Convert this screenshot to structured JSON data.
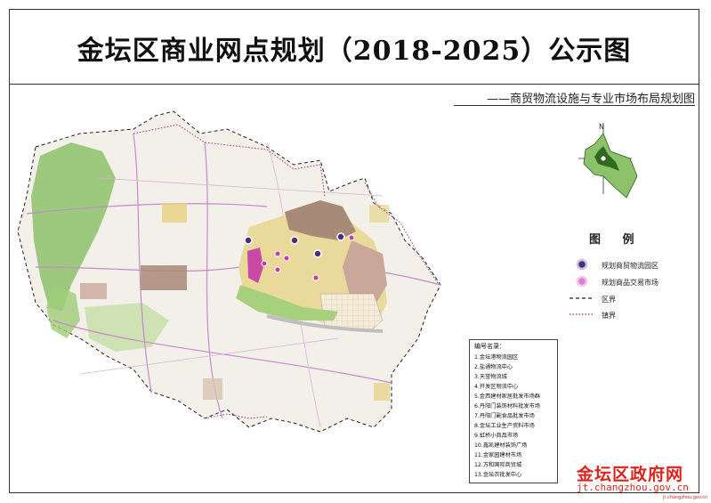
{
  "header": {
    "title": "金坛区商业网点规划（2018-2025）公示图",
    "subtitle": "——商贸物流设施与专业市场布局规划图"
  },
  "compass": {
    "north_label": "N"
  },
  "legend": {
    "title": "图 例",
    "items": [
      {
        "label": "规划商贸物流园区",
        "symbol": "purple-ringed-circle"
      },
      {
        "label": "规划商品交易市场",
        "symbol": "magenta-ringed-circle"
      },
      {
        "label": "区界",
        "symbol": "black-dashed-line"
      },
      {
        "label": "镇界",
        "symbol": "magenta-dotted-line"
      }
    ]
  },
  "numbering": {
    "title": "编号名录：",
    "items": [
      "1.金坛港物流园区",
      "2.盐通物流中心",
      "3.天誉物流城",
      "4.开发区物流中心",
      "5.金西建材家居批发市场群",
      "6.丹阳门装饰材料批发市场",
      "7.丹阳门副食品批发市场",
      "8.金坛工业生产资料市场",
      "9.虹桥小商品市场",
      "10.鑫凯建材装饰广场",
      "11.金家园建材市场",
      "12.方和国际商贸城",
      "13.金坛农批发中心"
    ]
  },
  "watermark": {
    "name": "金坛区政府网",
    "url": "jt.changzhou.gov.cn",
    "tag": "jt.changzhou.gov.cn"
  },
  "colors": {
    "purple_marker": "#4a2e7a",
    "magenta_marker": "#c43aa6",
    "district_boundary": "#222222",
    "town_boundary": "#a0307a",
    "green_area": "#8cc26a",
    "urban_brown": "#a88a78",
    "watermark_red": "#d9251c"
  }
}
